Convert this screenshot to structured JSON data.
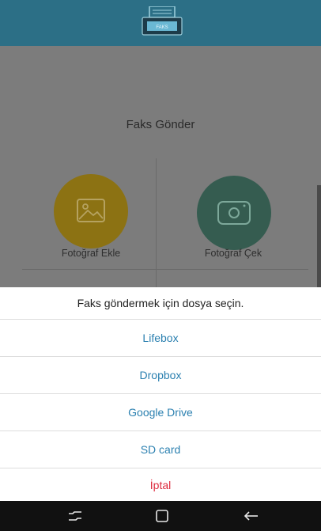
{
  "header": {
    "logo_text": "FAKS",
    "logo_icon": "fax-icon"
  },
  "page": {
    "title": "Faks Gönder",
    "actions": [
      {
        "label": "Fotoğraf Ekle",
        "icon": "image-icon",
        "color": "#8c7213"
      },
      {
        "label": "Fotoğraf Çek",
        "icon": "camera-icon",
        "color": "#355c50"
      }
    ]
  },
  "sheet": {
    "title": "Faks göndermek için dosya seçin.",
    "options": [
      "Lifebox",
      "Dropbox",
      "Google Drive",
      "SD card"
    ],
    "cancel": "İptal",
    "option_color": "#2b80b0",
    "cancel_color": "#dd2b3e"
  },
  "navbar": {
    "buttons": [
      "recent-apps-icon",
      "home-icon",
      "back-icon"
    ]
  }
}
